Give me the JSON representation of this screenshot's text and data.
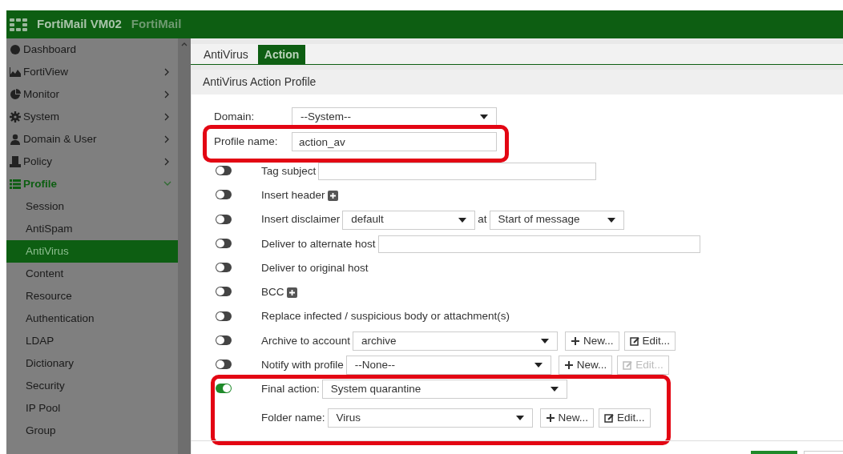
{
  "header": {
    "product": "FortiMail VM02",
    "title": "FortiMail"
  },
  "sidebar": {
    "items": [
      {
        "label": "Dashboard",
        "submenu": false,
        "expanded": false
      },
      {
        "label": "FortiView",
        "submenu": true,
        "expanded": false
      },
      {
        "label": "Monitor",
        "submenu": true,
        "expanded": false
      },
      {
        "label": "System",
        "submenu": true,
        "expanded": false
      },
      {
        "label": "Domain & User",
        "submenu": true,
        "expanded": false
      },
      {
        "label": "Policy",
        "submenu": true,
        "expanded": false
      },
      {
        "label": "Profile",
        "submenu": true,
        "expanded": true,
        "children": [
          {
            "label": "Session",
            "selected": false
          },
          {
            "label": "AntiSpam",
            "selected": false
          },
          {
            "label": "AntiVirus",
            "selected": true
          },
          {
            "label": "Content",
            "selected": false
          },
          {
            "label": "Resource",
            "selected": false
          },
          {
            "label": "Authentication",
            "selected": false
          },
          {
            "label": "LDAP",
            "selected": false
          },
          {
            "label": "Dictionary",
            "selected": false
          },
          {
            "label": "Security",
            "selected": false
          },
          {
            "label": "IP Pool",
            "selected": false
          },
          {
            "label": "Group",
            "selected": false
          }
        ]
      }
    ]
  },
  "tabs": [
    {
      "label": "AntiVirus",
      "selected": false
    },
    {
      "label": "Action",
      "selected": true
    }
  ],
  "panel": {
    "title": "AntiVirus Action Profile",
    "domain": {
      "label": "Domain:",
      "value": "--System--"
    },
    "profile_name": {
      "label": "Profile name:",
      "value": "action_av"
    },
    "actions": [
      {
        "kind": "text",
        "on": false,
        "label": "Tag subject"
      },
      {
        "kind": "plus",
        "on": false,
        "label": "Insert header"
      },
      {
        "kind": "disclaimer",
        "on": false,
        "label": "Insert disclaimer",
        "value": "default",
        "at_label": "at",
        "position": "Start of message"
      },
      {
        "kind": "text",
        "on": false,
        "label": "Deliver to alternate host"
      },
      {
        "kind": "plain",
        "on": false,
        "label": "Deliver to original host"
      },
      {
        "kind": "plus",
        "on": false,
        "label": "BCC"
      },
      {
        "kind": "plain",
        "on": false,
        "label": "Replace infected / suspicious body or attachment(s)"
      },
      {
        "kind": "select_buttons",
        "on": false,
        "label": "Archive to account",
        "value": "archive",
        "new_label": "New...",
        "edit_label": "Edit...",
        "edit_disabled": false
      },
      {
        "kind": "select_buttons",
        "on": false,
        "label": "Notify with profile",
        "value": "--None--",
        "new_label": "New...",
        "edit_label": "Edit...",
        "edit_disabled": true
      },
      {
        "kind": "final",
        "on": true,
        "label": "Final action:",
        "value": "System quarantine",
        "folder_label": "Folder name:",
        "folder": "Virus",
        "new_label": "New...",
        "edit_label": "Edit..."
      }
    ]
  }
}
